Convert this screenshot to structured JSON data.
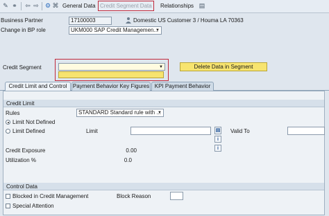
{
  "toolbar": {
    "general_data": "General Data",
    "credit_segment_data": "Credit Segment Data",
    "relationships": "Relationships"
  },
  "header": {
    "business_partner_label": "Business Partner",
    "business_partner_value": "17100003",
    "business_partner_desc": "Domestic US Customer 3 / Houma LA 70363",
    "bp_role_label": "Change in BP role",
    "bp_role_value": "UKM000 SAP Credit Managemen..."
  },
  "credit_segment": {
    "label": "Credit Segment",
    "value": "",
    "delete_button": "Delete Data in Segment"
  },
  "tabs": [
    {
      "label": "Credit Limit and Control"
    },
    {
      "label": "Payment Behavior Key Figures"
    },
    {
      "label": "KPI Payment Behavior"
    }
  ],
  "credit_limit": {
    "title": "Credit Limit",
    "rules_label": "Rules",
    "rules_value": "STANDARD Standard rule with ...",
    "limit_not_defined": "Limit Not Defined",
    "limit_defined": "Limit Defined",
    "limit_label": "Limit",
    "limit_value": "",
    "valid_to_label": "Valid To",
    "valid_to_value": "",
    "credit_exposure_label": "Credit Exposure",
    "credit_exposure_value": "0.00",
    "utilization_label": "Utilization %",
    "utilization_value": "0.0"
  },
  "control_data": {
    "title": "Control Data",
    "blocked_label": "Blocked in Credit Management",
    "block_reason_label": "Block Reason",
    "block_reason_value": "",
    "special_attention_label": "Special Attention"
  },
  "colors": {
    "highlight_red": "#c0283a",
    "required_yellow": "#f7e46f"
  }
}
